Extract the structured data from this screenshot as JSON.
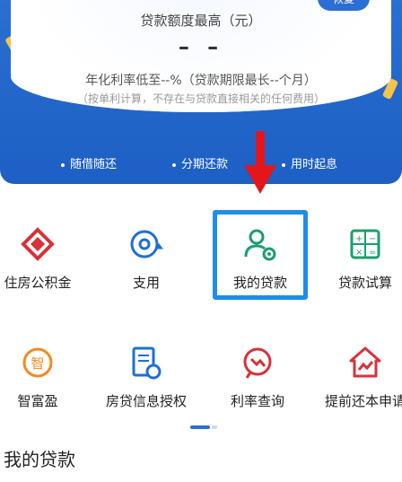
{
  "banner": {
    "badge": "恢复",
    "quota_label": "贷款额度最高（元）",
    "quota_value": "– –",
    "rate_line": "年化利率低至--%（贷款期限最长--个月）",
    "rate_note": "（按单利计算，不存在与贷款直接相关的任何费用）",
    "features": [
      "随借随还",
      "分期还款",
      "用时起息"
    ]
  },
  "services": [
    {
      "label": "住房公积金",
      "icon": "housing-fund-icon",
      "color": "#d6323a"
    },
    {
      "label": "支用",
      "icon": "withdraw-icon",
      "color": "#1e6fd6"
    },
    {
      "label": "我的贷款",
      "icon": "my-loan-icon",
      "color": "#1a9e6e"
    },
    {
      "label": "贷款试算",
      "icon": "calculator-icon",
      "color": "#1a9e6e"
    },
    {
      "label": "智富盈",
      "icon": "wealth-icon",
      "color": "#f08a24"
    },
    {
      "label": "房贷信息授权",
      "icon": "document-authorize-icon",
      "color": "#1e6fd6"
    },
    {
      "label": "利率查询",
      "icon": "rate-query-icon",
      "color": "#d6323a"
    },
    {
      "label": "提前还本申请",
      "icon": "house-prepay-icon",
      "color": "#d6323a"
    }
  ],
  "section": {
    "title": "我的贷款"
  },
  "colors": {
    "brand_blue": "#2a6fd1",
    "highlight": "#1e8ee8",
    "arrow": "#e3161b"
  }
}
